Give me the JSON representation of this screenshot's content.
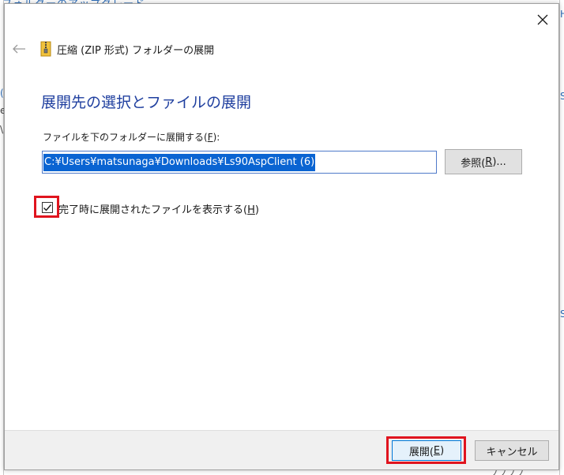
{
  "background": {
    "top_text": "フォルダーのアップグレード",
    "bottom_text": "ノノノノ"
  },
  "dialog": {
    "window_title": "圧縮 (ZIP 形式) フォルダーの展開",
    "heading": "展開先の選択とファイルの展開",
    "path_label": {
      "text": "ファイルを下のフォルダーに展開する(",
      "accesskey": "F",
      "suffix": "):"
    },
    "path_value": "C:¥Users¥matsunaga¥Downloads¥Ls90AspClient (6)",
    "browse_button": {
      "text": "参照(",
      "accesskey": "R",
      "suffix": ")..."
    },
    "show_files_checkbox": {
      "checked": true,
      "text": "完了時に展開されたファイルを表示する(",
      "accesskey": "H",
      "suffix": ")"
    },
    "extract_button": {
      "text": "展開(",
      "accesskey": "E",
      "suffix": ")"
    },
    "cancel_button": {
      "text": "キャンセル"
    }
  },
  "icons": {
    "close": "close-icon",
    "back": "back-arrow-icon",
    "zip": "zip-folder-icon",
    "check": "checkmark-icon"
  },
  "colors": {
    "heading": "#1f3f9f",
    "selection": "#0a64d2",
    "highlight_box": "#e0141e",
    "default_button_border": "#0078d7"
  }
}
